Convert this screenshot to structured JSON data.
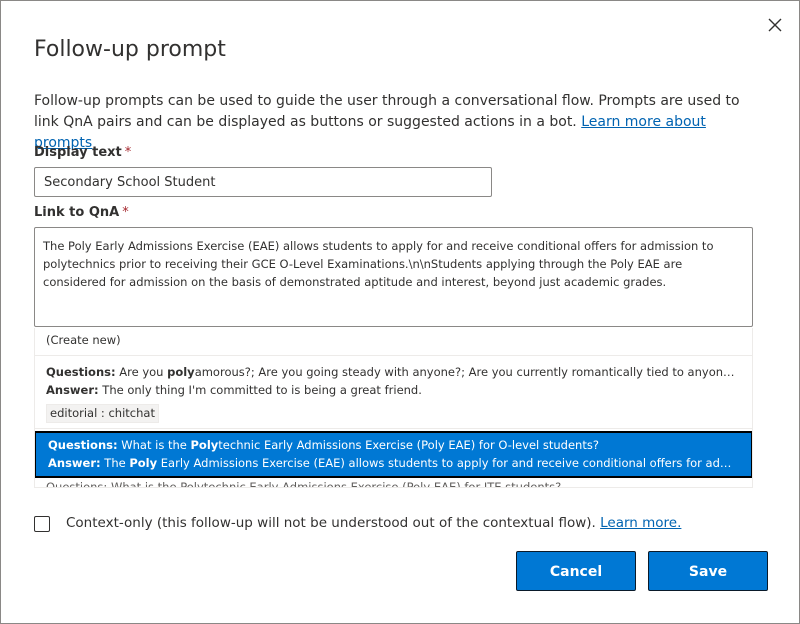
{
  "dialog": {
    "title": "Follow-up prompt",
    "description": "Follow-up prompts can be used to guide the user through a conversational flow. Prompts are used to link QnA pairs and can be displayed as buttons or suggested actions in a bot.",
    "learn_more_link": "Learn more about prompts",
    "close_icon": "close-icon"
  },
  "form": {
    "display_text_label": "Display text",
    "display_text_value": "Secondary School Student",
    "link_label": "Link to QnA",
    "required_marker": "*",
    "link_value": "The Poly Early Admissions Exercise (EAE) allows students to apply for and receive conditional offers for admission to polytechnics prior to receiving their GCE O-Level Examinations.\\n\\nStudents applying through the Poly EAE are considered for admission on the basis of demonstrated aptitude and interest, beyond just academic grades."
  },
  "suggestions": {
    "create_new": "(Create new)",
    "questions_label": "Questions:",
    "answer_label": "Answer:",
    "items": [
      {
        "q_pre": "Are you ",
        "q_bold": "poly",
        "q_post": "amorous?; Are you going steady with anyone?; Are you currently romantically tied to anyone?; ...",
        "a_pre": "The only thing I'm committed to is being a great friend.",
        "a_bold": "",
        "a_post": "",
        "tag": "editorial : chitchat"
      },
      {
        "q_pre": "What is the ",
        "q_bold": "Poly",
        "q_post": "technic Early Admissions Exercise (Poly EAE) for O-level students?",
        "a_pre": "The ",
        "a_bold": "Poly",
        "a_post": " Early Admissions Exercise (EAE) allows students to apply for and receive conditional offers for admiss..."
      }
    ],
    "partial_row": "Questions: What is the Polytechnic Early Admissions Exercise (Poly EAE) for ITE students?"
  },
  "context_only": {
    "label": "Context-only (this follow-up will not be understood out of the contextual flow).",
    "link": "Learn more.",
    "checked": false
  },
  "buttons": {
    "cancel": "Cancel",
    "save": "Save"
  },
  "colors": {
    "primary": "#0078d4",
    "link": "#0063b1",
    "required": "#a4262c"
  }
}
